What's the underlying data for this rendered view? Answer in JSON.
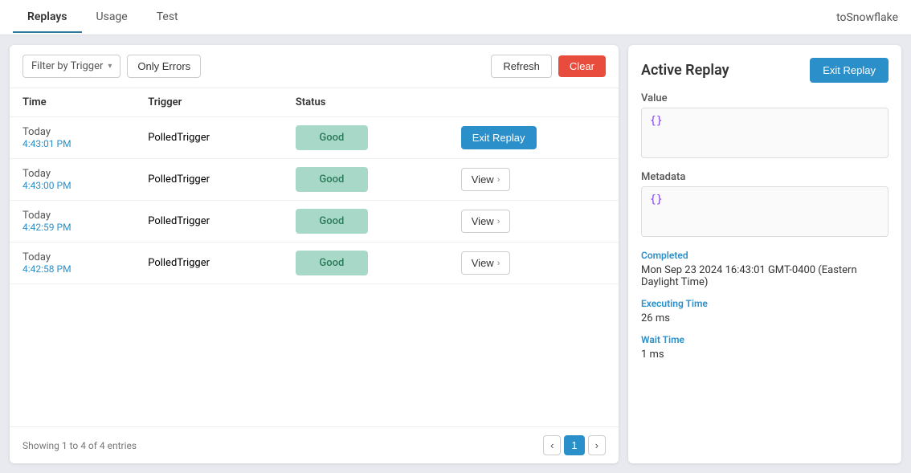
{
  "nav": {
    "tabs": [
      {
        "id": "replays",
        "label": "Replays",
        "active": true
      },
      {
        "id": "usage",
        "label": "Usage",
        "active": false
      },
      {
        "id": "test",
        "label": "Test",
        "active": false
      }
    ],
    "brand": "toSnowflake"
  },
  "toolbar": {
    "filter_placeholder": "Filter by Trigger",
    "only_errors_label": "Only Errors",
    "refresh_label": "Refresh",
    "clear_label": "Clear"
  },
  "table": {
    "columns": [
      "Time",
      "Trigger",
      "Status"
    ],
    "rows": [
      {
        "date": "Today",
        "time": "4:43:01 PM",
        "trigger": "PolledTrigger",
        "status": "Good",
        "action": "exit_replay"
      },
      {
        "date": "Today",
        "time": "4:43:00 PM",
        "trigger": "PolledTrigger",
        "status": "Good",
        "action": "view"
      },
      {
        "date": "Today",
        "time": "4:42:59 PM",
        "trigger": "PolledTrigger",
        "status": "Good",
        "action": "view"
      },
      {
        "date": "Today",
        "time": "4:42:58 PM",
        "trigger": "PolledTrigger",
        "status": "Good",
        "action": "view"
      }
    ],
    "exit_replay_label": "Exit Replay",
    "view_label": "View"
  },
  "pagination": {
    "summary": "Showing 1 to 4 of 4 entries",
    "current_page": 1
  },
  "side_panel": {
    "title": "Active Replay",
    "exit_button_label": "Exit Replay",
    "value_label": "Value",
    "value_content": "{}",
    "metadata_label": "Metadata",
    "metadata_content": "{}",
    "completed_label": "Completed",
    "completed_value": "Mon Sep 23 2024 16:43:01 GMT-0400 (Eastern Daylight Time)",
    "executing_time_label": "Executing Time",
    "executing_time_value": "26 ms",
    "wait_time_label": "Wait Time",
    "wait_time_value": "1 ms"
  }
}
